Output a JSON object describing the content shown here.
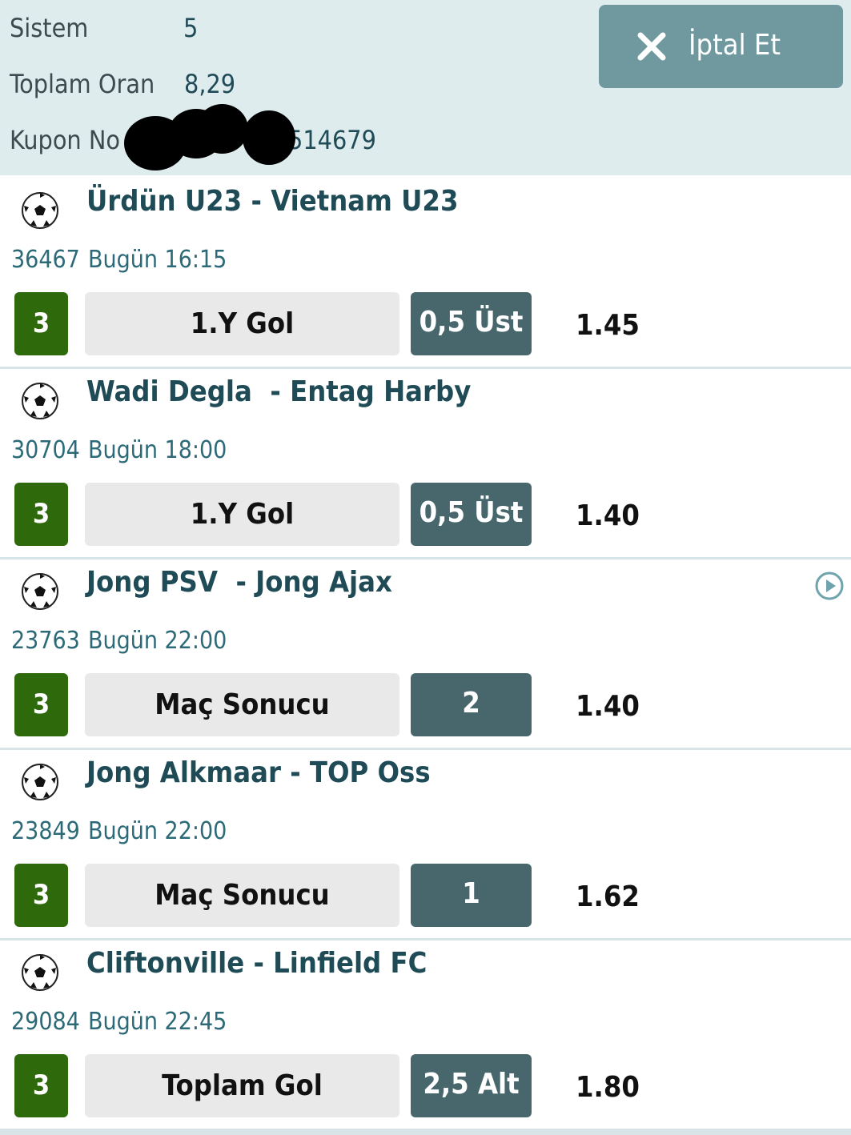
{
  "header": {
    "system_label": "Sistem",
    "system_value": "5",
    "total_odds_label": "Toplam Oran",
    "total_odds_value": "8,29",
    "coupon_label": "Kupon No",
    "coupon_value": "514679",
    "cancel_label": "İptal Et"
  },
  "matches": [
    {
      "teams": "Ürdün U23 - Vietnam U23",
      "code": "36467",
      "datetime": "Bugün 16:15",
      "badge": "3",
      "market": "1.Y Gol",
      "pick": "0,5 Üst",
      "odd": "1.45"
    },
    {
      "teams": "Wadi Degla  - Entag Harby",
      "code": "30704",
      "datetime": "Bugün 18:00",
      "badge": "3",
      "market": "1.Y Gol",
      "pick": "0,5 Üst",
      "odd": "1.40"
    },
    {
      "teams": "Jong PSV  - Jong Ajax",
      "code": "23763",
      "datetime": "Bugün 22:00",
      "badge": "3",
      "market": "Maç Sonucu",
      "pick": "2",
      "odd": "1.40"
    },
    {
      "teams": "Jong Alkmaar - TOP Oss",
      "code": "23849",
      "datetime": "Bugün 22:00",
      "badge": "3",
      "market": "Maç Sonucu",
      "pick": "1",
      "odd": "1.62"
    },
    {
      "teams": "Cliftonville - Linfield FC",
      "code": "29084",
      "datetime": "Bugün 22:45",
      "badge": "3",
      "market": "Toplam Gol",
      "pick": "2,5 Alt",
      "odd": "1.80"
    }
  ],
  "icons": {
    "ball": "soccer-ball-icon",
    "cancel": "close-icon",
    "live": "play-circle-icon"
  },
  "colors": {
    "header_bg": "#dfecee",
    "badge_green": "#2e6a0c",
    "pick_bg": "#48676d",
    "cancel_bg": "#6f989f",
    "text_teal": "#1f4b57"
  }
}
